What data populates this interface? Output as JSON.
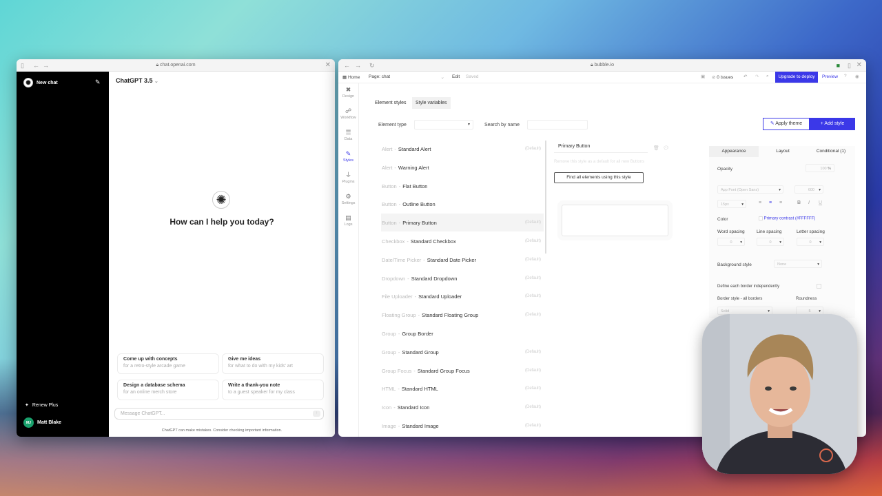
{
  "chatgpt": {
    "url": "chat.openai.com",
    "new_chat": "New chat",
    "model": "ChatGPT 3.5",
    "headline": "How can I help you today?",
    "suggestions": [
      {
        "title": "Come up with concepts",
        "sub": "for a retro-style arcade game"
      },
      {
        "title": "Give me ideas",
        "sub": "for what to do with my kids' art"
      },
      {
        "title": "Design a database schema",
        "sub": "for an online merch store"
      },
      {
        "title": "Write a thank-you note",
        "sub": "to a guest speaker for my class"
      }
    ],
    "input_placeholder": "Message ChatGPT...",
    "disclaimer": "ChatGPT can make mistakes. Consider checking important information.",
    "renew": "Renew Plus",
    "user_name": "Matt Blake",
    "user_initials": "MJ"
  },
  "bubble": {
    "url": "bubble.io",
    "home": "Home",
    "page": "Page: chat",
    "edit": "Edit",
    "saved": "Saved",
    "issues": "0 issues",
    "upgrade": "Upgrade to deploy",
    "preview": "Preview",
    "nav": [
      "Design",
      "Workflow",
      "Data",
      "Styles",
      "Plugins",
      "Settings",
      "Logs"
    ],
    "tabs": [
      "Element styles",
      "Style variables"
    ],
    "element_type_label": "Element type",
    "search_label": "Search by name",
    "apply_theme": "Apply theme",
    "add_style": "Add style",
    "default_label": "(Default)",
    "styles": [
      {
        "type": "Alert",
        "name": "Standard Alert"
      },
      {
        "type": "Alert",
        "name": "Warning Alert"
      },
      {
        "type": "Button",
        "name": "Flat Button"
      },
      {
        "type": "Button",
        "name": "Outline Button"
      },
      {
        "type": "Button",
        "name": "Primary Button"
      },
      {
        "type": "Checkbox",
        "name": "Standard Checkbox"
      },
      {
        "type": "Date/Time Picker",
        "name": "Standard Date Picker"
      },
      {
        "type": "Dropdown",
        "name": "Standard Dropdown"
      },
      {
        "type": "File Uploader",
        "name": "Standard Uploader"
      },
      {
        "type": "Floating Group",
        "name": "Standard Floating Group"
      },
      {
        "type": "Group",
        "name": "Group Border"
      },
      {
        "type": "Group",
        "name": "Standard Group"
      },
      {
        "type": "Group Focus",
        "name": "Standard Group Focus"
      },
      {
        "type": "HTML",
        "name": "Standard HTML"
      },
      {
        "type": "Icon",
        "name": "Standard Icon"
      },
      {
        "type": "Image",
        "name": "Standard Image"
      }
    ],
    "detail": {
      "style_name": "Primary Button",
      "remove_default": "Remove this style as a default for all new Buttons",
      "find_all": "Find all elements using this style"
    },
    "props": {
      "tabs": [
        "Appearance",
        "Layout",
        "Conditional (1)"
      ],
      "opacity_label": "Opacity",
      "opacity_value": "100",
      "opacity_unit": "%",
      "font": "App Font (Open Sans)",
      "weight": "600",
      "size": "15px",
      "color_label": "Color",
      "color_value": "Primary contrast (#FFFFFF)",
      "word_spacing": "Word spacing",
      "line_spacing": "Line spacing",
      "letter_spacing": "Letter spacing",
      "spacing_values": [
        "0",
        "0",
        "0"
      ],
      "bg_label": "Background style",
      "bg_value": "None",
      "border_indep": "Define each border independently",
      "border_style_label": "Border style - all borders",
      "border_style_value": "Solid",
      "roundness_label": "Roundness",
      "roundness_value": "5"
    }
  },
  "colors": {
    "accent": "#3b38e8",
    "sidebar": "#000000"
  }
}
